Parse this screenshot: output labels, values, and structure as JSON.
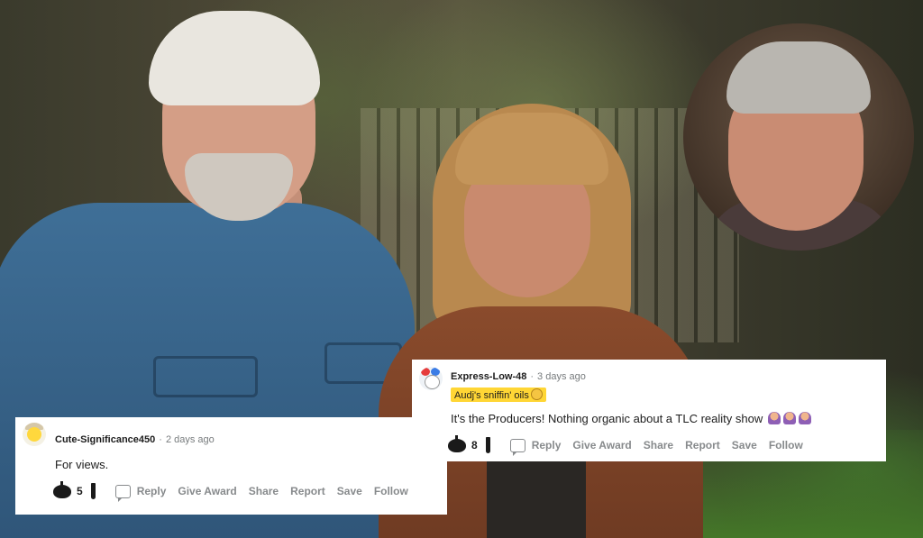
{
  "comments": [
    {
      "username": "Cute-Significance450",
      "time": "2 days ago",
      "flair": "",
      "text": "For views.",
      "votes": "5",
      "actions": [
        "Reply",
        "Give Award",
        "Share",
        "Report",
        "Save",
        "Follow"
      ]
    },
    {
      "username": "Express-Low-48",
      "time": "3 days ago",
      "flair": "Audj's sniffin' oils",
      "text": "It's the Producers! Nothing organic about a TLC reality show",
      "votes": "8",
      "actions": [
        "Reply",
        "Give Award",
        "Share",
        "Report",
        "Save",
        "Follow"
      ]
    }
  ],
  "separator": "·",
  "icons": {
    "upvote": "pumpkin-upvote-icon",
    "downvote": "downvote-icon",
    "reply": "comment-bubble-icon",
    "flair_emoji": "smiley-emoji-icon",
    "text_emoji": "person-gesturing-emoji-icon"
  },
  "colors": {
    "flair_bg": "#ffd635",
    "meta_text": "#787c7e",
    "action_text": "#878a8c"
  }
}
